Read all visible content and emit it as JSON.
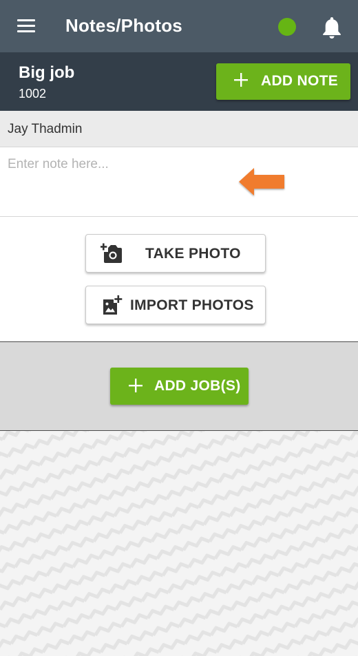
{
  "appbar": {
    "title": "Notes/Photos",
    "menu_icon": "hamburger-menu-icon",
    "status_icon": "online-status-dot",
    "status_color": "#66b514",
    "notification_icon": "bell-icon"
  },
  "job": {
    "title": "Big job",
    "number": "1002",
    "add_note_label": "ADD NOTE",
    "add_note_icon": "plus-icon"
  },
  "note": {
    "author": "Jay Thadmin",
    "value": "",
    "placeholder": "Enter note here...",
    "pointer_icon": "left-arrow-icon"
  },
  "photos": {
    "take_photo_label": "TAKE PHOTO",
    "take_photo_icon": "add-camera-icon",
    "import_photos_label": "IMPORT PHOTOS",
    "import_photos_icon": "add-image-icon"
  },
  "jobs": {
    "add_jobs_label": "ADD JOB(S)",
    "add_jobs_icon": "plus-icon"
  },
  "colors": {
    "appbar": "#4c5a66",
    "jobbar": "#333e49",
    "primary_green": "#6cb31b",
    "arrow_orange": "#f07c2e"
  }
}
